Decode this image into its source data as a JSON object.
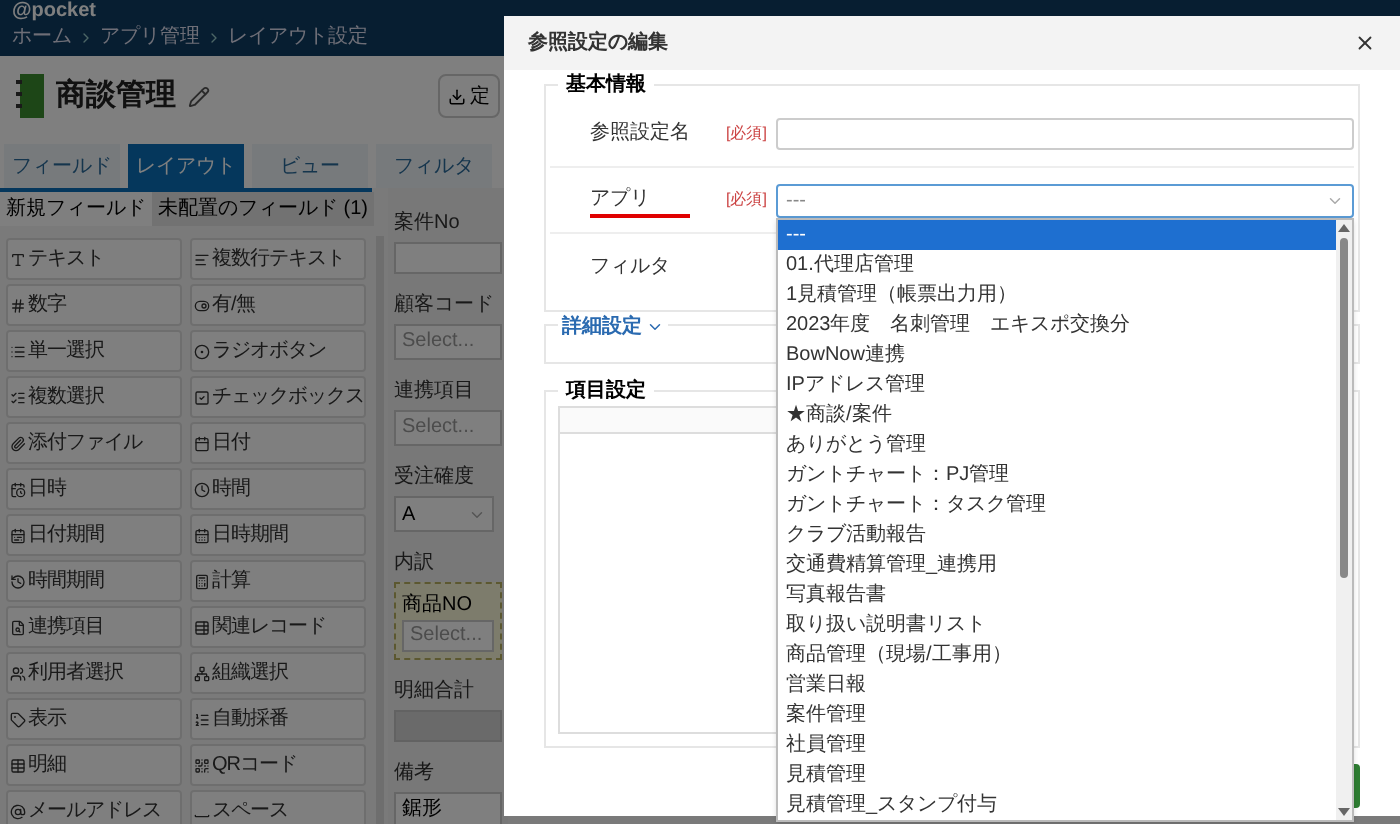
{
  "header": {
    "logo": "@pocket",
    "breadcrumbs": [
      "ホーム",
      "アプリ管理",
      "レイアウト設定"
    ]
  },
  "app": {
    "title": "商談管理",
    "button": "定"
  },
  "tabs": [
    {
      "label": "フィールド",
      "selected": false
    },
    {
      "label": "レイアウト",
      "selected": true
    },
    {
      "label": "ビュー",
      "selected": false
    },
    {
      "label": "フィルタ",
      "selected": false
    }
  ],
  "palette_tabs": [
    {
      "label": "新規フィールド",
      "selected": true
    },
    {
      "label": "未配置のフィールド (1)",
      "selected": false
    }
  ],
  "palette": [
    "テキスト",
    "複数行テキスト",
    "数字",
    "有/無",
    "単一選択",
    "ラジオボタン",
    "複数選択",
    "チェックボックス",
    "添付ファイル",
    "日付",
    "日時",
    "時間",
    "日付期間",
    "日時期間",
    "時間期間",
    "計算",
    "連携項目",
    "関連レコード",
    "利用者選択",
    "組織選択",
    "表示",
    "自動採番",
    "明細",
    "QRコード",
    "メールアドレス",
    "スペース"
  ],
  "form_fields": [
    {
      "label": "案件No",
      "kind": "input"
    },
    {
      "label": "顧客コード",
      "kind": "select",
      "placeholder": "Select..."
    },
    {
      "label": "連携項目",
      "kind": "select",
      "placeholder": "Select..."
    },
    {
      "label": "受注確度",
      "kind": "dropdown",
      "value": "A"
    },
    {
      "label": "内訳",
      "kind": "table",
      "children": [
        {
          "label": "商品NO",
          "placeholder": "Select..."
        }
      ]
    },
    {
      "label": "明細合計",
      "kind": "readonly"
    },
    {
      "label": "備考",
      "kind": "textarea",
      "value": "鋸形"
    }
  ],
  "dialog": {
    "title": "参照設定の編集",
    "basic": {
      "legend": "基本情報",
      "rows": [
        {
          "label": "参照設定名",
          "required": "[必須]",
          "kind": "text",
          "underlined": false
        },
        {
          "label": "アプリ",
          "required": "[必須]",
          "kind": "select",
          "value": "---",
          "underlined": true
        },
        {
          "label": "フィルタ",
          "kind": "none",
          "underlined": false
        }
      ]
    },
    "advanced": {
      "label": "詳細設定",
      "expanded": false
    },
    "items": {
      "legend": "項目設定"
    },
    "dropdown": [
      {
        "label": "---",
        "selected": true
      },
      {
        "label": "01.代理店管理",
        "selected": false
      },
      {
        "label": "1見積管理（帳票出力用）",
        "selected": false
      },
      {
        "label": "2023年度　名刺管理　エキスポ交換分",
        "selected": false
      },
      {
        "label": "BowNow連携",
        "selected": false
      },
      {
        "label": "IPアドレス管理",
        "selected": false
      },
      {
        "label": "★商談/案件",
        "selected": false
      },
      {
        "label": "ありがとう管理",
        "selected": false
      },
      {
        "label": "ガントチャート：PJ管理",
        "selected": false
      },
      {
        "label": "ガントチャート：タスク管理",
        "selected": false
      },
      {
        "label": "クラブ活動報告",
        "selected": false
      },
      {
        "label": "交通費精算管理_連携用",
        "selected": false
      },
      {
        "label": "写真報告書",
        "selected": false
      },
      {
        "label": "取り扱い説明書リスト",
        "selected": false
      },
      {
        "label": "商品管理（現場/工事用）",
        "selected": false
      },
      {
        "label": "営業日報",
        "selected": false
      },
      {
        "label": "案件管理",
        "selected": false
      },
      {
        "label": "社員管理",
        "selected": false
      },
      {
        "label": "見積管理",
        "selected": false
      },
      {
        "label": "見積管理_スタンプ付与",
        "selected": false
      }
    ]
  }
}
